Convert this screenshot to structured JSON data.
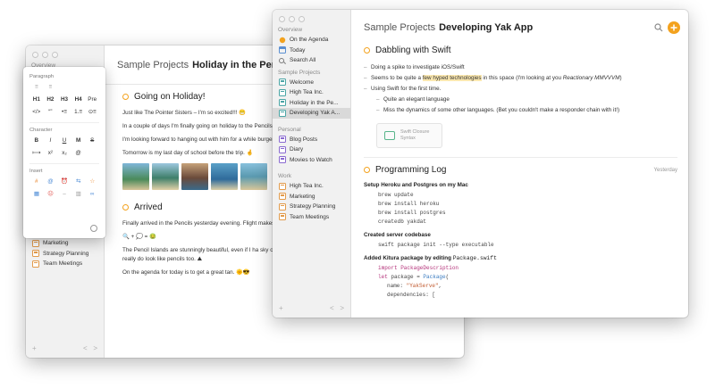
{
  "back_window": {
    "title_project": "Sample Projects",
    "title_doc": "Holiday in the Pencils",
    "sidebar": {
      "overview_partial": "Overview",
      "items": [
        {
          "label": "Marketing"
        },
        {
          "label": "Strategy Planning"
        },
        {
          "label": "Team Meetings"
        }
      ],
      "footer_add": "+",
      "footer_back": "<",
      "footer_fwd": ">"
    },
    "note1": {
      "heading": "Going on Holiday!",
      "p1": "Just like The Pointer Sisters – I'm so excited!!! 😁",
      "p2": "In a couple of days I'm finally going on holiday to the Pencils trip with him since my parents split up 3 years ago.",
      "p3": "I'm looking forward to hanging out with him for a while burgers to hilltops, or something like that. Don't get it",
      "p4": "Tomorrow is my last day of school before the trip. 🤞"
    },
    "note2": {
      "heading": "Arrived",
      "p1": "Finally arrived in the Pencils yesterday evening. Flight makes for some pretty rocky turbulence. Wasn't long b the airport.",
      "p1b": "🔍 + 💭 = 🤢",
      "p2": "The Pencil Islands are stunningly beautiful, even if I ha sky changes hue, and the mountains take on different shades of color. They really do look like pencils too. ⛰",
      "p3": "On the agenda for today is to get a great tan. 🌞😎"
    }
  },
  "popover": {
    "paragraph_label": "Paragraph",
    "paragraph_row1": [
      "≡",
      "≡",
      "",
      "",
      ""
    ],
    "paragraph_row2": [
      "H1",
      "H2",
      "H3",
      "H4",
      "Pre"
    ],
    "paragraph_row3": [
      "</>",
      "“”",
      "•≡",
      "1.≡",
      "⊙≡"
    ],
    "character_label": "Character",
    "character_row1": [
      "B",
      "I",
      "U",
      "M",
      "S"
    ],
    "character_row2": [
      "⟼",
      "x²",
      "x₂",
      "@",
      ""
    ],
    "insert_label": "Insert",
    "insert_row1": [
      "#",
      "@",
      "⏰",
      "⇆",
      "☆"
    ],
    "insert_row2": [
      "▦",
      "☹",
      "–",
      "▥",
      "∞"
    ]
  },
  "front_window": {
    "title_project": "Sample Projects",
    "title_doc": "Developing Yak App",
    "sidebar": {
      "overview_label": "Overview",
      "overview_items": [
        "On the Agenda",
        "Today",
        "Search All"
      ],
      "sample_label": "Sample Projects",
      "sample_items": [
        "Welcome",
        "High Tea Inc.",
        "Holiday in the Pe...",
        "Developing Yak A..."
      ],
      "personal_label": "Personal",
      "personal_items": [
        "Blog Posts",
        "Diary",
        "Movies to Watch"
      ],
      "work_label": "Work",
      "work_items": [
        "High Tea Inc.",
        "Marketing",
        "Strategy Planning",
        "Team Meetings"
      ],
      "footer_add": "+",
      "footer_back": "<",
      "footer_fwd": ">"
    },
    "note1": {
      "heading": "Dabbling with Swift",
      "b1": "Doing a spike to investigate iOS/Swift",
      "b2_pre": "Seems to be quite a ",
      "b2_hl": "few hyped technologies",
      "b2_post": " in this space (I'm looking at you ",
      "b2_italic": "Reactionary MMVVVM",
      "b2_end": ")",
      "b3": "Using Swift for the first time.",
      "b3a": "Quite an elegant language",
      "b3b": "Miss the dynamics of some other languages. (Bet you couldn't make a responder chain with it!)",
      "chip": "Swift Closure Syntax"
    },
    "note2": {
      "heading": "Programming Log",
      "date": "Yesterday",
      "s1_title": "Setup Heroku and Postgres on my Mac",
      "s1_code": [
        "brew update",
        "brew install heroku",
        "brew install postgres",
        "createdb yakdat"
      ],
      "s2_title": "Created server codebase",
      "s2_code": "swift package init --type executable",
      "s3_title_pre": "Added Kitura package by editing ",
      "s3_title_code": "Package.swift",
      "s3_line1": "import PackageDescription",
      "s3_line2_kw": "let",
      "s3_line2_mid": " package = ",
      "s3_line2_fn": "Package",
      "s3_line2_end": "(",
      "s3_line3_pre": "name: ",
      "s3_line3_str": "\"YakServe\"",
      "s3_line3_end": ",",
      "s3_line4": "dependencies: ["
    }
  },
  "colors": {
    "accent": "#f3a21e",
    "highlight": "#fbe8b0",
    "selected_row": "#d9d9d9"
  },
  "icons": {
    "search": "search-icon",
    "add": "add-note-icon",
    "gear": "gear-icon"
  }
}
